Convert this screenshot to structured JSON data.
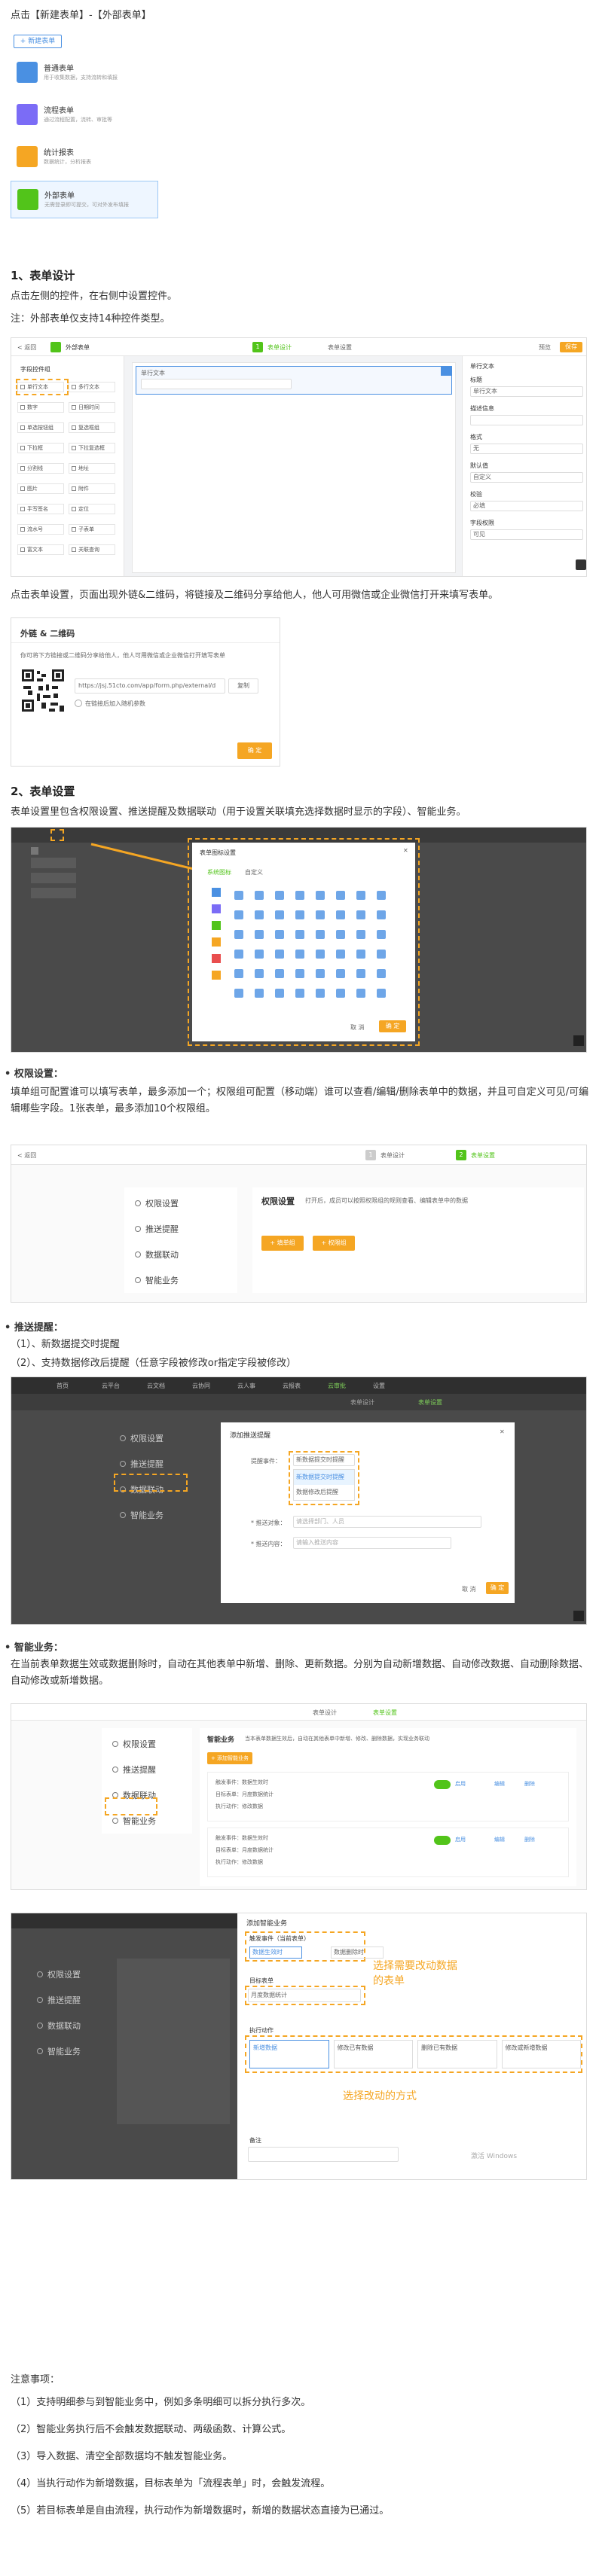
{
  "intro": "点击【新建表单】-【外部表单】",
  "new_form_menu": {
    "button": "+ 新建表单",
    "items": [
      {
        "title": "普通表单",
        "desc": "用于收集数据，支持流转和填报",
        "color": "#4a90e2"
      },
      {
        "title": "流程表单",
        "desc": "通过流程配置，流转、审批等",
        "color": "#7b6cf6"
      },
      {
        "title": "统计报表",
        "desc": "数据统计，分析报表",
        "color": "#f5a623"
      },
      {
        "title": "外部表单",
        "desc": "无需登录即可提交，可对外发布填报",
        "color": "#52c41a"
      }
    ]
  },
  "s1": {
    "heading": "1、表单设计",
    "p1": "点击左侧的控件，在右侧中设置控件。",
    "p2": "注：外部表单仅支持14种控件类型。",
    "editor": {
      "back": "< 返回",
      "form_name": "外部表单",
      "tab_design": "表单设计",
      "tab_settings": "表单设置",
      "preview": "预览",
      "save": "保存",
      "group_label": "字段控件组",
      "controls": [
        "单行文本",
        "多行文本",
        "数字",
        "日期时间",
        "单选按钮组",
        "复选框组",
        "下拉框",
        "下拉复选框",
        "分割线",
        "地址",
        "图片",
        "附件",
        "手写签名",
        "定位",
        "流水号",
        "子表单",
        "富文本",
        "关联查询"
      ],
      "canvas_field": "单行文本",
      "props_title": "单行文本",
      "props": [
        {
          "label": "标题",
          "value": "单行文本"
        },
        {
          "label": "描述信息",
          "value": ""
        },
        {
          "label": "格式",
          "value": "无"
        },
        {
          "label": "默认值",
          "value": "自定义"
        },
        {
          "label": "校验",
          "value": "必填"
        },
        {
          "label": "字段权限",
          "value": "可见"
        }
      ]
    },
    "p3": "点击表单设置，页面出现外链&二维码，将链接及二维码分享给他人，他人可用微信或企业微信打开来填写表单。",
    "share": {
      "title": "外链 & 二维码",
      "desc": "你可将下方链接或二维码分享给他人，他人可用微信或企业微信打开填写表单",
      "url": "https://jsj.51cto.com/app/form.php/external/d",
      "copy": "复制",
      "option": "在链接后加入随机参数",
      "ok": "确 定"
    }
  },
  "s2": {
    "heading": "2、表单设置",
    "p1": "表单设置里包含权限设置、推送提醒及数据联动（用于设置关联填充选择数据时显示的字段）、智能业务。",
    "icon_dialog": {
      "title": "表单图标设置",
      "tabs": [
        "系统图标",
        "自定义"
      ],
      "cancel": "取 消",
      "ok": "确 定"
    }
  },
  "perm": {
    "label": "权限设置：",
    "desc": "填单组可配置谁可以填写表单，最多添加一个；权限组可配置（移动端）谁可以查看/编辑/删除表单中的数据，并且可自定义可见/可编辑哪些字段。1张表单，最多添加10个权限组。",
    "shot": {
      "back": "< 返回",
      "tab_design": "表单设计",
      "tab_settings": "表单设置",
      "menu": [
        "权限设置",
        "推送提醒",
        "数据联动",
        "智能业务"
      ],
      "title": "权限设置",
      "hint": "打开后，成员可以按照权限组的规则查看、编辑表单中的数据",
      "add_fill": "+ 填单组",
      "add_perm": "+ 权限组"
    }
  },
  "push": {
    "label": "推送提醒：",
    "items": [
      "（1）、新数据提交时提醒",
      "（2）、支持数据修改后提醒（任意字段被修改or指定字段被修改）"
    ],
    "shot": {
      "top_tabs": [
        "首页",
        "云平台",
        "云文档",
        "云协同",
        "云人事",
        "云报表",
        "云审批",
        "设置"
      ],
      "tab_design": "表单设计",
      "tab_settings": "表单设置",
      "menu": [
        "权限设置",
        "推送提醒",
        "数据联动",
        "智能业务"
      ],
      "dialog_title": "添加推送提醒",
      "trigger_label": "提醒事件：",
      "trigger_value": "新数据提交时提醒",
      "options": [
        "新数据提交时提醒",
        "数据修改后提醒"
      ],
      "target_label": "* 推送对象：",
      "target_placeholder": "请选择部门、人员",
      "content_label": "* 推送内容：",
      "content_placeholder": "请输入推送内容",
      "cancel": "取 消",
      "ok": "确 定"
    }
  },
  "smart": {
    "label": "智能业务：",
    "desc": "在当前表单数据生效或数据删除时，自动在其他表单中新增、删除、更新数据。分别为自动新增数据、自动修改数据、自动删除数据、自动修改或新增数据。",
    "shot1": {
      "tab_design": "表单设计",
      "tab_settings": "表单设置",
      "menu": [
        "权限设置",
        "推送提醒",
        "数据联动",
        "智能业务"
      ],
      "title": "智能业务",
      "hint": "当本表单数据生效后，自动在其他表单中新增、修改、删除数据，实现业务联动",
      "add": "+ 添加智能业务",
      "rules": [
        {
          "event": "触发事件：数据生效时",
          "target": "目标表单：月度数据统计",
          "action": "执行动作：修改数据",
          "enable": "启用",
          "edit": "编辑",
          "del": "删除"
        },
        {
          "event": "触发事件：数据生效时",
          "target": "目标表单：月度数据统计",
          "action": "执行动作：修改数据",
          "enable": "启用",
          "edit": "编辑",
          "del": "删除"
        }
      ]
    },
    "shot2": {
      "dialog_title": "添加智能业务",
      "trigger_label": "触发事件（当前表单）",
      "trigger_options": [
        "数据生效时",
        "数据删除时"
      ],
      "target_label": "目标表单",
      "target_value": "月度数据统计",
      "action_label": "执行动作",
      "actions": [
        "新增数据",
        "修改已有数据",
        "删除已有数据",
        "修改或新增数据"
      ],
      "note_label": "备注",
      "callout1": "选择需要改动数据的表单",
      "callout2": "选择改动的方式",
      "watermark": "激活 Windows",
      "menu": [
        "权限设置",
        "推送提醒",
        "数据联动",
        "智能业务"
      ]
    }
  },
  "notes": {
    "title": "注意事项：",
    "items": [
      "（1）支持明细参与到智能业务中，例如多条明细可以拆分执行多次。",
      "（2）智能业务执行后不会触发数据联动、两级函数、计算公式。",
      "（3）导入数据、清空全部数据均不触发智能业务。",
      "（4）当执行动作为新增数据，目标表单为「流程表单」时，会触发流程。",
      "（5）若目标表单是自由流程，执行动作为新增数据时，新增的数据状态直接为已通过。"
    ]
  }
}
